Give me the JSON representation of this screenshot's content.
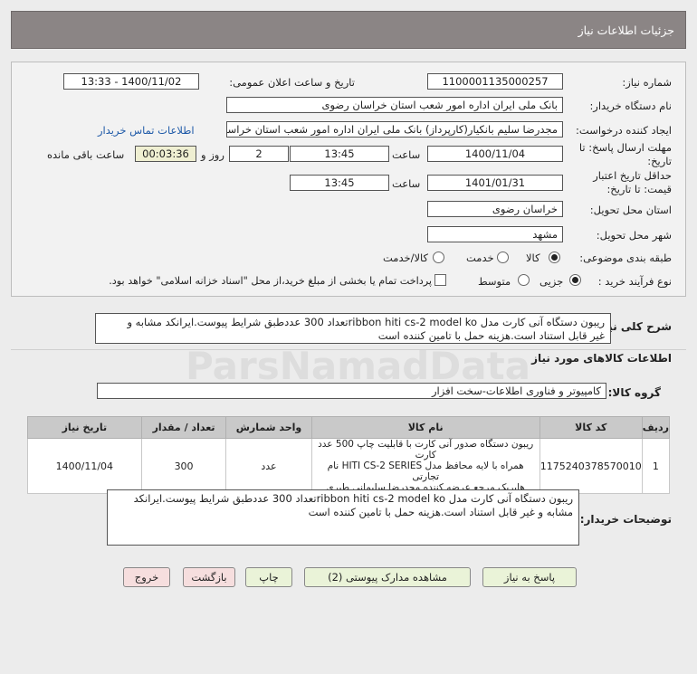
{
  "header": {
    "title": "جزئیات اطلاعات نیاز"
  },
  "fields": {
    "need_number_label": "شماره نیاز:",
    "need_number": "1100001135000257",
    "announce_label": "تاریخ و ساعت اعلان عمومی:",
    "announce_value": "1400/11/02 - 13:33",
    "buyer_label": "نام دستگاه خریدار:",
    "buyer_value": "بانک ملی ایران اداره امور شعب استان خراسان رضوی",
    "creator_label": "ایجاد کننده درخواست:",
    "creator_value": "مجدرضا سلیم  بانکیار(کارپرداز) بانک ملی ایران اداره امور شعب استان خراسان رضوی",
    "contact_link": "اطلاعات تماس خریدار",
    "deadline_label": "مهلت ارسال پاسخ: تا تاریخ:",
    "deadline_date": "1400/11/04",
    "time_label": "ساعت",
    "deadline_time": "13:45",
    "days_value": "2",
    "days_label": "روز و",
    "remaining_time": "00:03:36",
    "remaining_label": "ساعت باقی مانده",
    "validity_label": "حداقل تاریخ اعتبار قیمت: تا تاریخ:",
    "validity_date": "1401/01/31",
    "validity_time": "13:45",
    "province_label": "استان محل تحویل:",
    "province_value": "خراسان رضوی",
    "city_label": "شهر محل تحویل:",
    "city_value": "مشهد",
    "category_label": "طبقه بندی موضوعی:",
    "category_options": [
      "کالا",
      "خدمت",
      "کالا/خدمت"
    ],
    "process_label": "نوع فرآیند خرید :",
    "process_options": [
      "جزیی",
      "متوسط"
    ],
    "payment_note": "پرداخت تمام یا بخشی از مبلغ خرید،از محل \"اسناد خزانه اسلامی\" خواهد بود."
  },
  "description": {
    "label": "شرح کلی نیاز:",
    "line1": "ریبون دستگاه آنی کارت مدل ribbon hiti cs-2 model koتعداد 300 عددطبق شرایط پیوست.ایرانکد مشابه و",
    "line2": "غیر قابل استناد است.هزینه حمل با تامین کننده است"
  },
  "goods": {
    "section_title": "اطلاعات کالاهای مورد نیاز",
    "group_label": "گروه کالا:",
    "group_value": "کامپیوتر و فناوری اطلاعات-سخت افزار",
    "columns": [
      "ردیف",
      "کد کالا",
      "نام کالا",
      "واحد شمارش",
      "تعداد / مقدار",
      "تاریخ نیاز"
    ],
    "rows": [
      {
        "index": "1",
        "code": "1175240378570010",
        "name1": "ریبون دستگاه صدور آنی کارت با قابلیت چاپ 500 عدد کارت",
        "name2": "همراه با لایه محافظ مدل HITI CS-2 SERIES نام تجارتی",
        "name3": "هایریک مرجع عرضه کننده مجدرضا سلیمانی طبری",
        "unit": "عدد",
        "qty": "300",
        "date": "1400/11/04"
      }
    ]
  },
  "buyer_notes": {
    "label": "توضیحات خریدار:",
    "line1": "ریبون دستگاه آنی کارت مدل ribbon hiti cs-2 model koتعداد 300 عددطبق شرایط پیوست.ایرانکد",
    "line2": "مشابه و غیر قابل استناد است.هزینه حمل با تامین کننده است"
  },
  "buttons": {
    "reply": "پاسخ به نیاز",
    "attachments": "مشاهده مدارک پیوستی (2)",
    "print": "چاپ",
    "back": "بازگشت",
    "exit": "خروج"
  }
}
